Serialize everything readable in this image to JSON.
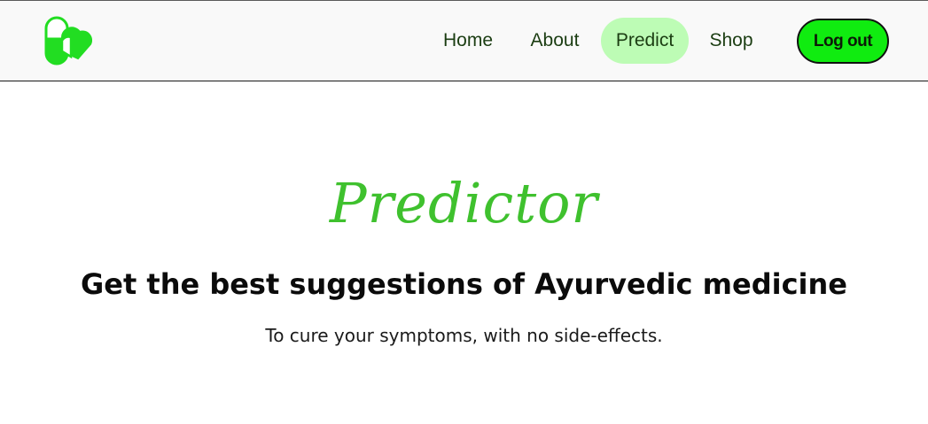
{
  "header": {
    "logo_icon": "capsule-heart-icon",
    "nav": {
      "home": "Home",
      "about": "About",
      "predict": "Predict",
      "shop": "Shop"
    },
    "active_item": "Predict",
    "logout_label": "Log out"
  },
  "hero": {
    "title": "Predictor",
    "subtitle": "Get the best suggestions of Ayurvedic medicine",
    "tagline": "To cure your symptoms, with no side-effects."
  },
  "colors": {
    "brand_green": "#10ec10",
    "title_green": "#3fc12e",
    "active_pill": "#bdfcb5",
    "nav_text": "#1b3d12"
  }
}
